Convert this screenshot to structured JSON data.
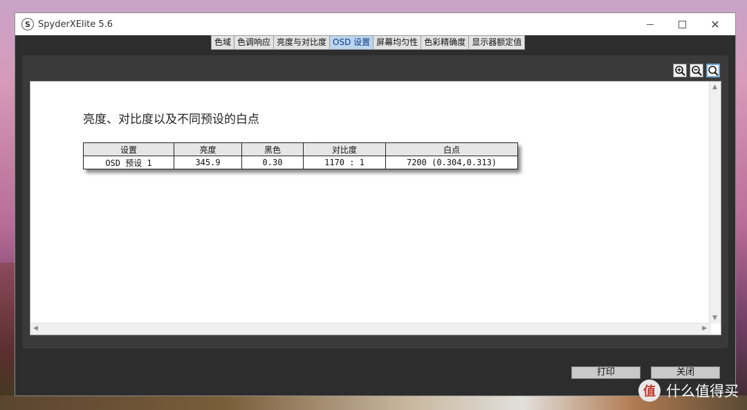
{
  "window": {
    "title": "SpyderXElite 5.6"
  },
  "tabs": [
    {
      "label": "色域"
    },
    {
      "label": "色调响应"
    },
    {
      "label": "亮度与对比度"
    },
    {
      "label": "OSD 设置",
      "active": true
    },
    {
      "label": "屏幕均匀性"
    },
    {
      "label": "色彩精确度"
    },
    {
      "label": "显示器额定值"
    }
  ],
  "zoom": {
    "icons": [
      "zoom-in-icon",
      "zoom-out-icon",
      "zoom-fit-icon"
    ]
  },
  "report": {
    "title": "亮度、对比度以及不同预设的白点",
    "columns": [
      "设置",
      "亮度",
      "黑色",
      "对比度",
      "白点"
    ],
    "rows": [
      [
        "OSD 预设 1",
        "345.9",
        "0.30",
        "1170 : 1",
        "7200 (0.304,0.313)"
      ]
    ]
  },
  "buttons": {
    "print": "打印",
    "close": "关闭"
  },
  "watermark": {
    "text": "什么值得买",
    "logo": "值"
  },
  "colors": {
    "active_tab": "#bcd6ef",
    "window_bg": "#2d2d2d",
    "button_bg": "#c9c9c9"
  }
}
